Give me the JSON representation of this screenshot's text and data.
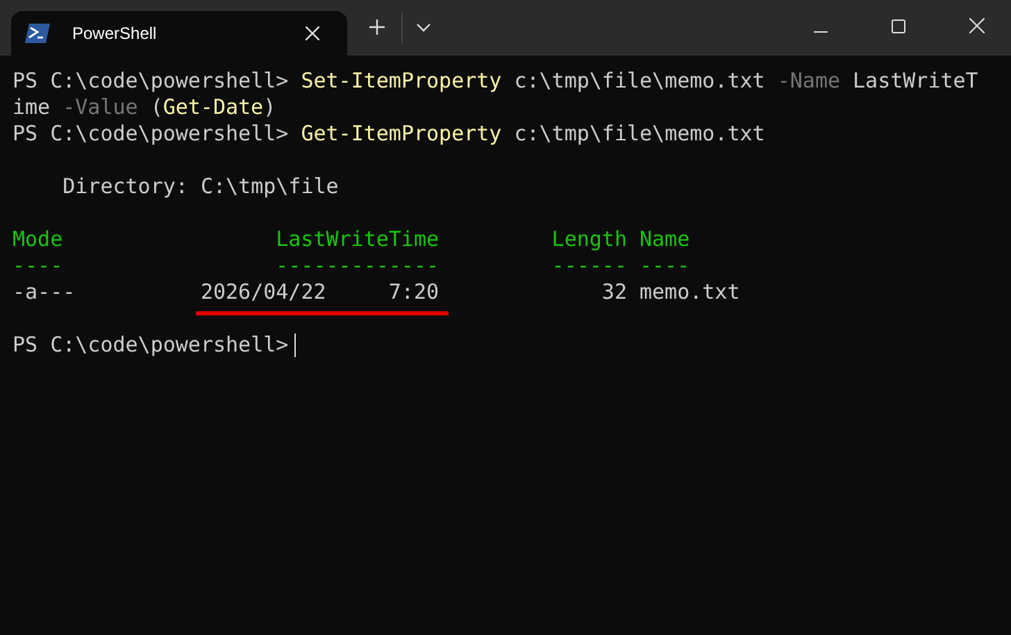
{
  "window": {
    "tab": {
      "title": "PowerShell",
      "selected": true
    }
  },
  "blocks": [
    {
      "lines": [
        [
          {
            "kind": "prompt",
            "text": "PS C:\\code\\powershell>"
          },
          {
            "kind": "command",
            "text": "Set-ItemProperty"
          },
          {
            "kind": "arg",
            "text": "c:\\tmp\\file\\memo.txt"
          },
          {
            "kind": "param",
            "text": "-Name"
          },
          {
            "kind": "arg",
            "text": "LastWriteT"
          }
        ],
        [
          {
            "kind": "arg",
            "text": "ime"
          },
          {
            "kind": "param",
            "text": "-Value"
          },
          [
            {
              "kind": "arg",
              "text": "("
            },
            {
              "kind": "command",
              "text": "Get-Date"
            },
            {
              "kind": "arg",
              "text": ")"
            }
          ]
        ],
        [
          {
            "kind": "prompt",
            "text": "PS C:\\code\\powershell>"
          },
          {
            "kind": "command",
            "text": "Get-ItemProperty"
          },
          {
            "kind": "arg",
            "text": "c:\\tmp\\file\\memo.txt"
          }
        ]
      ]
    },
    {
      "directory": "Directory: C:\\tmp\\file"
    },
    {
      "table": {
        "columns": [
          {
            "label": "Mode",
            "rule": "----"
          },
          {
            "label": "LastWriteTime",
            "rule": "-------------"
          },
          {
            "label": "Length",
            "rule": "------"
          },
          {
            "label": "Name",
            "rule": "----"
          }
        ],
        "rows": [
          {
            "mode": "-a---",
            "date": "2026/04/22",
            "time": "7:20",
            "length": "32",
            "name": "memo.txt",
            "highlighted": true
          }
        ]
      }
    },
    {
      "lines": [
        [
          {
            "kind": "prompt",
            "text": "PS C:\\code\\powershell>"
          }
        ]
      ],
      "cursor": true
    }
  ]
}
